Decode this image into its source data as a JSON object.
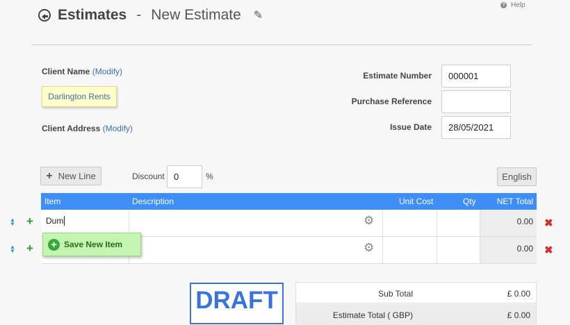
{
  "help": {
    "label": "Help"
  },
  "header": {
    "title": "Estimates",
    "separator": "-",
    "subtitle": "New Estimate",
    "back_icon": "back-circle-arrow-icon",
    "edit_icon": "pencil-icon"
  },
  "client": {
    "name_label": "Client Name",
    "name_modify": "(Modify)",
    "name_value": "Darlington Rents",
    "address_label": "Client Address",
    "address_modify": "(Modify)"
  },
  "details": {
    "estimate_number_label": "Estimate Number",
    "estimate_number_value": "000001",
    "purchase_reference_label": "Purchase Reference",
    "purchase_reference_value": "",
    "issue_date_label": "Issue Date",
    "issue_date_value": "28/05/2021"
  },
  "toolbar": {
    "new_line_label": "New Line",
    "discount_label": "Discount",
    "discount_value": "0",
    "discount_unit": "%",
    "language_label": "English"
  },
  "table": {
    "columns": [
      "Item",
      "Description",
      "Unit Cost",
      "Qty",
      "NET Total"
    ],
    "rows": [
      {
        "item": "Dum",
        "description": "",
        "unit_cost": "",
        "qty": "",
        "net_total": "0.00"
      },
      {
        "item": "",
        "description": "",
        "unit_cost": "",
        "qty": "",
        "net_total": "0.00"
      }
    ]
  },
  "popup": {
    "label": "Save New Item"
  },
  "status": {
    "stamp": "DRAFT"
  },
  "totals": {
    "sub_total_label": "Sub Total",
    "sub_total_value": "£ 0.00",
    "estimate_total_label": "Estimate Total ( GBP)",
    "estimate_total_value": "£ 0.00"
  },
  "colors": {
    "accent": "#3f8ef5",
    "draft": "#3b73d9",
    "add": "#2ca02c",
    "remove": "#d32f2f"
  }
}
